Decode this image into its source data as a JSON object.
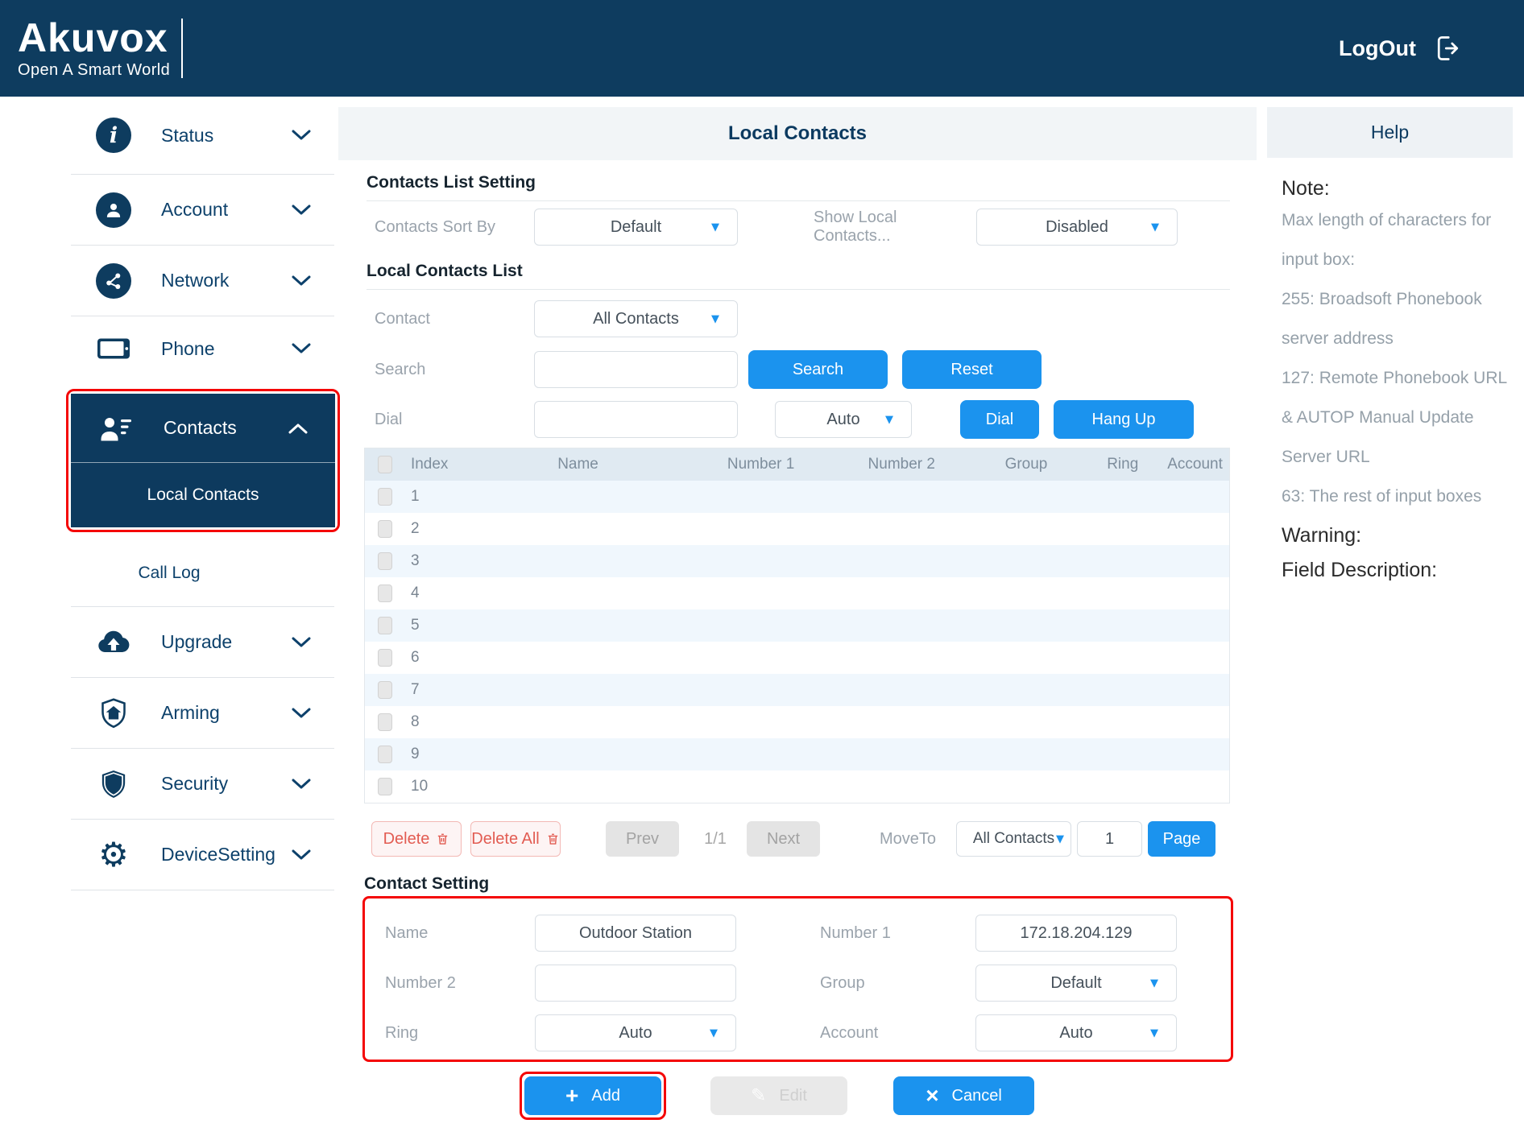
{
  "colors": {
    "header_navy": "#0e3c5f",
    "selected_navy": "#0d3a5e",
    "accent_blue": "#1b93ee",
    "annotation_red": "#f40606",
    "delete_red": "#e25c52"
  },
  "icons": {
    "caret_down": "▼",
    "gear": "⚙",
    "pencil": "✎",
    "plus": "+",
    "close": "×",
    "info": "i"
  },
  "header": {
    "brand": "Akuvox",
    "tagline": "Open A Smart World",
    "logout_label": "LogOut"
  },
  "sidebar": {
    "items": [
      {
        "label": "Status",
        "icon": "info-icon"
      },
      {
        "label": "Account",
        "icon": "user-icon"
      },
      {
        "label": "Network",
        "icon": "network-icon"
      },
      {
        "label": "Phone",
        "icon": "phone-icon"
      },
      {
        "label": "Contacts",
        "icon": "contacts-icon"
      },
      {
        "label": "Local Contacts",
        "icon": "none"
      },
      {
        "label": "Call Log",
        "icon": "none"
      },
      {
        "label": "Upgrade",
        "icon": "cloud-upload-icon"
      },
      {
        "label": "Arming",
        "icon": "shield-home-icon"
      },
      {
        "label": "Security",
        "icon": "shield-icon"
      },
      {
        "label": "DeviceSetting",
        "icon": "gear-icon"
      }
    ]
  },
  "main": {
    "title": "Local Contacts",
    "contacts_list_setting": {
      "heading": "Contacts List Setting",
      "sort_by_label": "Contacts Sort By",
      "sort_by_value": "Default",
      "show_local_label": "Show Local Contacts...",
      "show_local_value": "Disabled"
    },
    "local_contacts_list": {
      "heading": "Local Contacts List",
      "contact_label": "Contact",
      "contact_value": "All Contacts",
      "search_label": "Search",
      "search_value": "",
      "search_button": "Search",
      "reset_button": "Reset",
      "dial_label": "Dial",
      "dial_value": "",
      "dial_mode_value": "Auto",
      "dial_button": "Dial",
      "hangup_button": "Hang Up"
    },
    "table": {
      "columns": [
        "Index",
        "Name",
        "Number 1",
        "Number 2",
        "Group",
        "Ring",
        "Account"
      ],
      "rows": [
        "1",
        "2",
        "3",
        "4",
        "5",
        "6",
        "7",
        "8",
        "9",
        "10"
      ]
    },
    "pagination": {
      "delete_button": "Delete",
      "delete_all_button": "Delete All",
      "prev_button": "Prev",
      "page_indicator": "1/1",
      "next_button": "Next",
      "move_to_label": "MoveTo",
      "move_to_value": "All Contacts",
      "page_input": "1",
      "page_button": "Page"
    },
    "contact_setting": {
      "heading": "Contact Setting",
      "name_label": "Name",
      "name_value": "Outdoor Station",
      "number1_label": "Number 1",
      "number1_value": "172.18.204.129",
      "number2_label": "Number 2",
      "number2_value": "",
      "group_label": "Group",
      "group_value": "Default",
      "ring_label": "Ring",
      "ring_value": "Auto",
      "account_label": "Account",
      "account_value": "Auto",
      "add_button": "Add",
      "edit_button": "Edit",
      "cancel_button": "Cancel"
    }
  },
  "help": {
    "title": "Help",
    "note_heading": "Note:",
    "lines": [
      "Max length of characters for",
      "input box:",
      "255: Broadsoft Phonebook",
      "server address",
      "127: Remote Phonebook URL",
      "& AUTOP Manual Update",
      "Server URL",
      "63: The rest of input boxes"
    ],
    "warning_heading": "Warning:",
    "field_description_heading": "Field Description:"
  }
}
